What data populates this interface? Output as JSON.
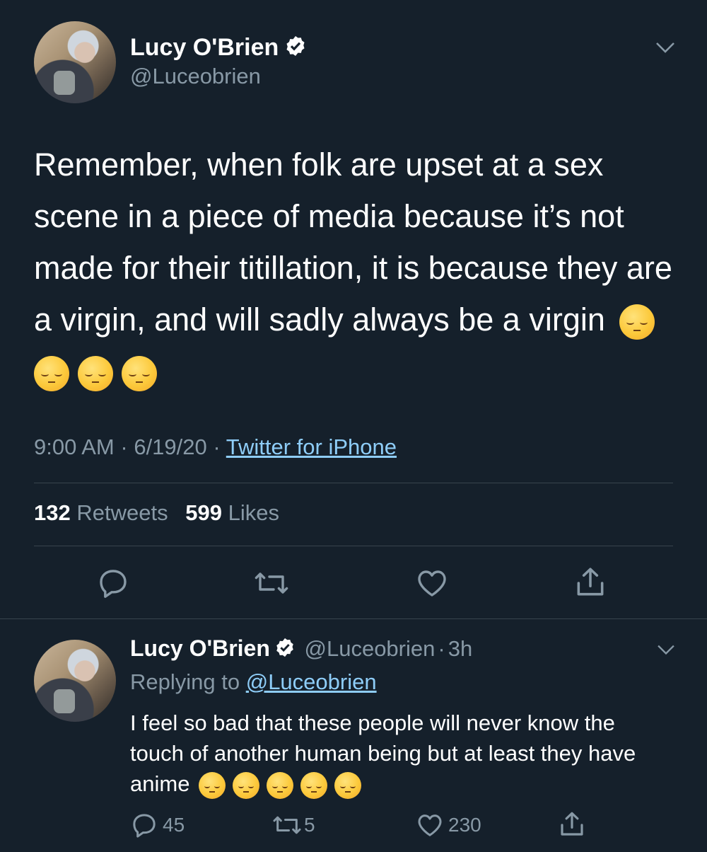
{
  "main_tweet": {
    "author_name": "Lucy O'Brien",
    "author_handle": "@Luceobrien",
    "text": "Remember, when folk are upset at a sex scene in a piece of media because it’s not made for their titillation, it is because they are a virgin, and will sadly always be a virgin",
    "emoji_count": 4,
    "time": "9:00 AM",
    "date": "6/19/20",
    "separator": "·",
    "source": "Twitter for iPhone",
    "retweets_count": "132",
    "retweets_label": "Retweets",
    "likes_count": "599",
    "likes_label": "Likes"
  },
  "reply_tweet": {
    "author_name": "Lucy O'Brien",
    "author_handle": "@Luceobrien",
    "separator": "·",
    "age": "3h",
    "replying_to_prefix": "Replying to",
    "replying_to_handle": "@Luceobrien",
    "text": "I feel so bad that these people will never know the touch of another human being but at least they have anime",
    "emoji_count": 5,
    "reply_count": "45",
    "retweet_count": "5",
    "like_count": "230"
  },
  "colors": {
    "background": "#15202b",
    "muted": "#8899a6",
    "link": "#8ecdf8",
    "verified": "#ffffff",
    "divider": "#38444d"
  },
  "icons": [
    "verified-badge-icon",
    "chevron-down-icon",
    "reply-icon",
    "retweet-icon",
    "like-icon",
    "share-icon",
    "pensive-face-emoji"
  ]
}
